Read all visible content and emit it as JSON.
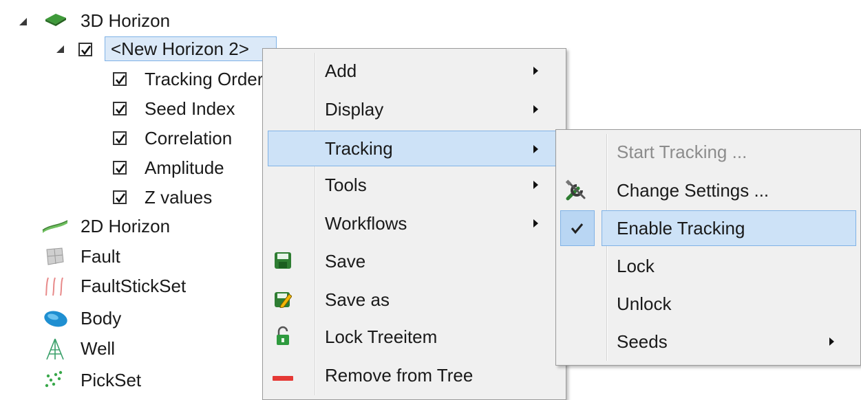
{
  "tree": {
    "root": {
      "label": "3D Horizon",
      "icon": "horizon-3d-icon"
    },
    "child": {
      "label": "<New Horizon 2>",
      "checked": true
    },
    "attributes": [
      {
        "label": "Tracking Order",
        "checked": true
      },
      {
        "label": "Seed Index",
        "checked": true
      },
      {
        "label": "Correlation",
        "checked": true
      },
      {
        "label": "Amplitude",
        "checked": true
      },
      {
        "label": "Z values",
        "checked": true
      }
    ],
    "types": [
      {
        "label": "2D Horizon",
        "icon": "horizon-2d-icon"
      },
      {
        "label": "Fault",
        "icon": "fault-icon"
      },
      {
        "label": "FaultStickSet",
        "icon": "faultstickset-icon"
      },
      {
        "label": "Body",
        "icon": "body-icon"
      },
      {
        "label": "Well",
        "icon": "well-icon"
      },
      {
        "label": "PickSet",
        "icon": "pickset-icon"
      }
    ]
  },
  "context_menu": {
    "items": [
      {
        "label": "Add",
        "submenu": true
      },
      {
        "label": "Display",
        "submenu": true
      },
      {
        "label": "Tracking",
        "submenu": true,
        "highlighted": true
      },
      {
        "label": "Tools",
        "submenu": true
      },
      {
        "label": "Workflows",
        "submenu": true
      },
      {
        "label": "Save",
        "icon": "save-icon"
      },
      {
        "label": "Save as",
        "icon": "save-as-icon"
      },
      {
        "label": "Lock Treeitem",
        "icon": "lock-open-icon"
      },
      {
        "label": "Remove from Tree",
        "icon": "remove-icon"
      }
    ]
  },
  "tracking_submenu": {
    "items": [
      {
        "label": "Start Tracking ...",
        "disabled": true
      },
      {
        "label": "Change Settings ...",
        "icon": "tools-icon"
      },
      {
        "label": "Enable Tracking",
        "checked": true,
        "highlighted": true
      },
      {
        "label": "Lock"
      },
      {
        "label": "Unlock"
      },
      {
        "label": "Seeds",
        "submenu": true
      }
    ]
  },
  "colors": {
    "highlight_bg": "#cde2f7",
    "highlight_border": "#7fb2e6",
    "menu_bg": "#f0f0f0"
  }
}
